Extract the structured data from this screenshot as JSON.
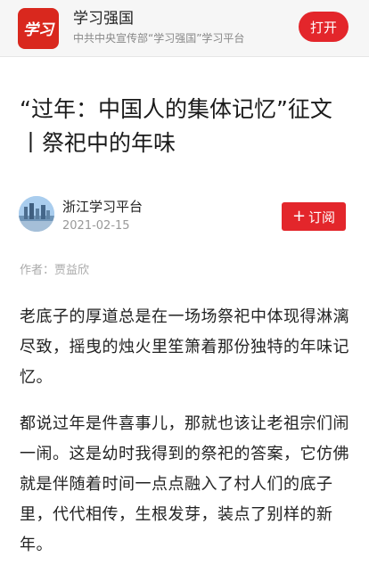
{
  "app_bar": {
    "name": "学习强国",
    "subtitle": "中共中央宣传部“学习强国”学习平台",
    "open_label": "打开",
    "logo_text": "学习",
    "brand_color": "#e3262b"
  },
  "article": {
    "title": "“过年：中国人的集体记忆”征文丨祭祀中的年味",
    "source": {
      "name": "浙江学习平台",
      "date": "2021-02-15",
      "subscribe_label": "订阅",
      "subscribe_icon": "plus-icon"
    },
    "byline": "作者：贾益欣",
    "paragraphs": [
      "老底子的厚道总是在一场场祭祀中体现得淋漓尽致，摇曳的烛火里笙箫着那份独特的年味记忆。",
      "都说过年是件喜事儿，那就也该让老祖宗们闹一闹。这是幼时我得到的祭祀的答案，它仿佛就是伴随着时间一点点融入了村人们的底子里，代代相传，生根发芽，装点了别样的新年。"
    ]
  }
}
